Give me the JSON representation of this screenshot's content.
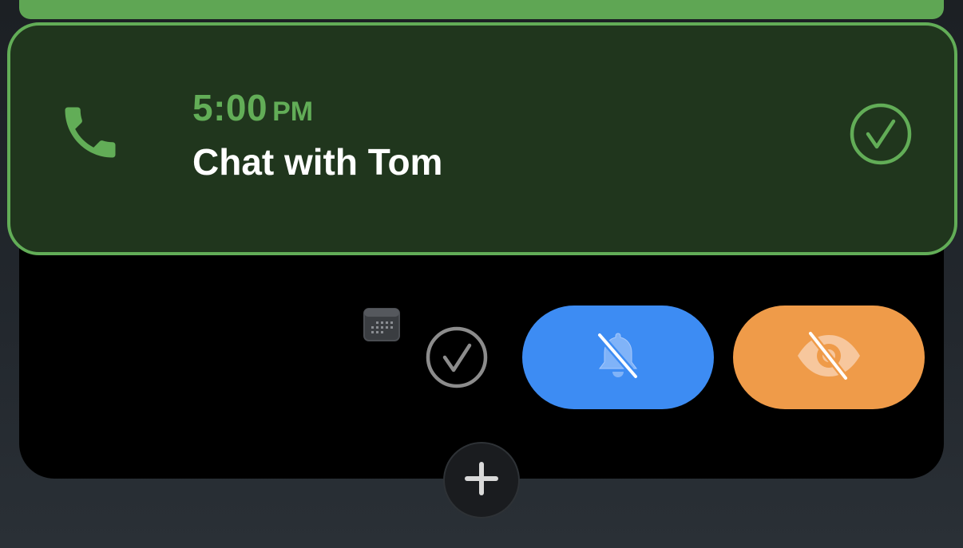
{
  "colors": {
    "card_background": "#20361d",
    "accent_green": "#62ad57",
    "mute_blue": "#3d8cf3",
    "hide_orange": "#ef9b49",
    "tray_background": "#000000"
  },
  "event": {
    "time": "5:00",
    "meridiem": "PM",
    "title": "Chat with Tom",
    "icon": "phone-icon",
    "completed": true
  },
  "actions": [
    {
      "name": "calendar",
      "icon": "calendar-icon"
    },
    {
      "name": "complete",
      "icon": "checkmark-circle-icon"
    },
    {
      "name": "mute",
      "icon": "bell-slash-icon"
    },
    {
      "name": "hide",
      "icon": "eye-slash-icon"
    }
  ],
  "add_button": {
    "icon": "plus-icon"
  }
}
